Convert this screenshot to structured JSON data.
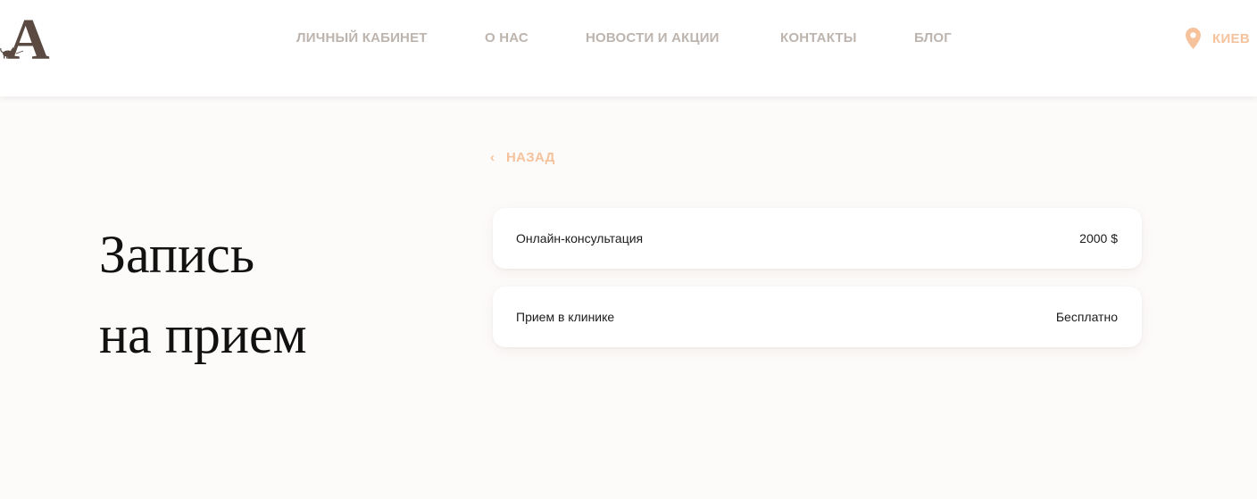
{
  "header": {
    "logo_text": "A",
    "nav": [
      {
        "label": "ЛИЧНЫЙ КАБИНЕТ"
      },
      {
        "label": "О НАС"
      },
      {
        "label": "НОВОСТИ И АКЦИИ"
      },
      {
        "label": "КОНТАКТЫ"
      },
      {
        "label": "БЛОГ"
      }
    ],
    "city": {
      "label": "КИЕВ",
      "icon": "location-pin-icon"
    }
  },
  "back": {
    "label": "НАЗАД",
    "icon": "chevron-left-icon"
  },
  "title": {
    "line1": "Запись",
    "line2": "на прием"
  },
  "services": [
    {
      "name": "Онлайн-консультация",
      "price": "2000 $"
    },
    {
      "name": "Прием в клинике",
      "price": "Бесплатно"
    }
  ],
  "colors": {
    "accent": "#f5c29c",
    "nav_text": "#bdb4ae",
    "logo": "#5a4a42",
    "background": "#fdfbfa"
  }
}
